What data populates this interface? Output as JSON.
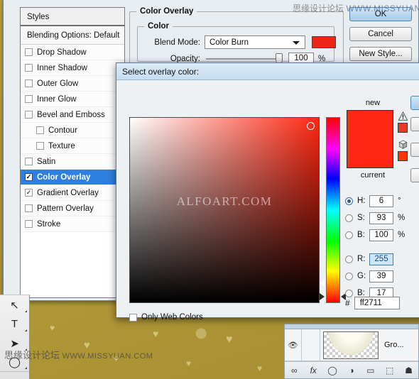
{
  "layer_style_dialog": {
    "styles_panel": {
      "header": "Styles",
      "blending_options": "Blending Options: Default",
      "items": [
        {
          "label": "Drop Shadow",
          "checked": false,
          "indent": false,
          "selected": false
        },
        {
          "label": "Inner Shadow",
          "checked": false,
          "indent": false,
          "selected": false
        },
        {
          "label": "Outer Glow",
          "checked": false,
          "indent": false,
          "selected": false
        },
        {
          "label": "Inner Glow",
          "checked": false,
          "indent": false,
          "selected": false
        },
        {
          "label": "Bevel and Emboss",
          "checked": false,
          "indent": false,
          "selected": false
        },
        {
          "label": "Contour",
          "checked": false,
          "indent": true,
          "selected": false
        },
        {
          "label": "Texture",
          "checked": false,
          "indent": true,
          "selected": false
        },
        {
          "label": "Satin",
          "checked": false,
          "indent": false,
          "selected": false
        },
        {
          "label": "Color Overlay",
          "checked": true,
          "indent": false,
          "selected": true
        },
        {
          "label": "Gradient Overlay",
          "checked": true,
          "indent": false,
          "selected": false
        },
        {
          "label": "Pattern Overlay",
          "checked": false,
          "indent": false,
          "selected": false
        },
        {
          "label": "Stroke",
          "checked": false,
          "indent": false,
          "selected": false
        }
      ]
    },
    "color_overlay": {
      "section_title": "Color Overlay",
      "group_title": "Color",
      "blend_mode_label": "Blend Mode:",
      "blend_mode_value": "Color Burn",
      "color_swatch": "#ee2414",
      "opacity_label": "Opacity:",
      "opacity_value": "100",
      "opacity_unit": "%"
    },
    "buttons": {
      "ok": "OK",
      "cancel": "Cancel",
      "new_style": "New Style..."
    }
  },
  "color_picker": {
    "title": "Select overlay color:",
    "new_label": "new",
    "current_label": "current",
    "new_color": "#ff2711",
    "current_color": "#ff2711",
    "warning_swatch": "#e8392b",
    "websafe_swatch": "#ff3300",
    "field_watermark": "ALFOART.COM",
    "only_web_colors_label": "Only Web Colors",
    "only_web_colors_checked": false,
    "hex_prefix": "#",
    "hex_value": "ff2711",
    "selected_channel": "H",
    "channels": [
      {
        "key": "H",
        "label": "H:",
        "value": "6",
        "unit": "°",
        "selected": true
      },
      {
        "key": "S",
        "label": "S:",
        "value": "93",
        "unit": "%",
        "selected": false
      },
      {
        "key": "B",
        "label": "B:",
        "value": "100",
        "unit": "%",
        "selected": false
      },
      {
        "key": "R",
        "label": "R:",
        "value": "255",
        "unit": "",
        "selected": false,
        "highlighted": true
      },
      {
        "key": "G",
        "label": "G:",
        "value": "39",
        "unit": "",
        "selected": false
      },
      {
        "key": "B2",
        "label": "B:",
        "value": "17",
        "unit": "",
        "selected": false
      }
    ]
  },
  "toolbox": {
    "tools": [
      {
        "icon": "↖",
        "name": "move-tool"
      },
      {
        "icon": "T",
        "name": "type-tool"
      },
      {
        "icon": "➤",
        "name": "path-selection-tool"
      },
      {
        "icon": "◯",
        "name": "ellipse-shape-tool"
      }
    ]
  },
  "layers_panel": {
    "layer_name": "Gro...",
    "bottom_icons": [
      "∞",
      "fx",
      "◯",
      "◑",
      "▭",
      "⬚",
      "☗"
    ]
  },
  "watermarks": {
    "top_cn": "思缘设计论坛",
    "top_en": "WWW.MISSYUAN.COM",
    "bottom_cn": "思缘设计论坛",
    "bottom_en": "WWW.MISSYUAN.COM"
  }
}
